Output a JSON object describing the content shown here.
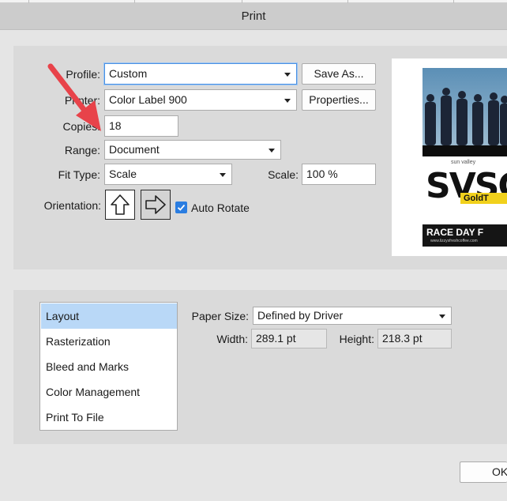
{
  "window": {
    "title": "Print"
  },
  "form": {
    "profile_label": "Profile:",
    "profile_value": "Custom",
    "save_as_label": "Save As...",
    "printer_label": "Printer:",
    "printer_value": "Color Label 900",
    "properties_label": "Properties...",
    "copies_label": "Copies:",
    "copies_value": "18",
    "range_label": "Range:",
    "range_value": "Document",
    "fit_type_label": "Fit Type:",
    "fit_type_value": "Scale",
    "scale_label": "Scale:",
    "scale_value": "100 %",
    "orientation_label": "Orientation:",
    "orientation_selected": "portrait",
    "auto_rotate_label": "Auto Rotate",
    "auto_rotate_checked": true
  },
  "preview": {
    "logo_text": "SVSC",
    "logo_small_text": "sun valley",
    "banner_text": "GoldT",
    "footer_text": "RACE DAY F",
    "url_text": "www.lizzysfreshcoffee.com"
  },
  "categories": {
    "items": [
      "Layout",
      "Rasterization",
      "Bleed and Marks",
      "Color Management",
      "Print To File"
    ],
    "selected": "Layout"
  },
  "layout": {
    "paper_size_label": "Paper Size:",
    "paper_size_value": "Defined by Driver",
    "width_label": "Width:",
    "width_value": "289.1 pt",
    "height_label": "Height:",
    "height_value": "218.3 pt"
  },
  "footer": {
    "ok_label": "OK"
  },
  "colors": {
    "annotation_arrow": "#e8434a",
    "selected_category": "#b9d8f7",
    "checkbox": "#2a7de1"
  }
}
